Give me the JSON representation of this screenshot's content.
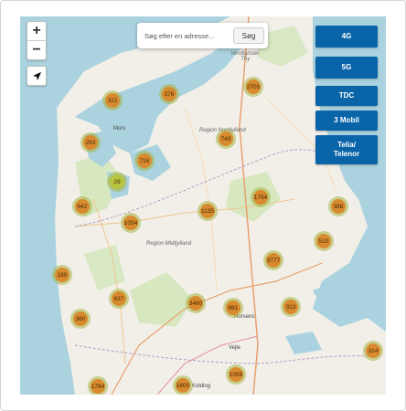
{
  "search": {
    "placeholder": "Søg efter en adresse...",
    "button": "Søg"
  },
  "zoom": {
    "in": "+",
    "out": "−"
  },
  "operators": [
    {
      "label": "4G"
    },
    {
      "label": "5G"
    },
    {
      "label": "TDC"
    },
    {
      "label": "3 Mobil"
    },
    {
      "label": "Telia/\nTelenor"
    }
  ],
  "regions": [
    {
      "name": "Vendsyssel-\nThy"
    },
    {
      "name": "Region Nordjylland"
    },
    {
      "name": "Region Midtjylland"
    }
  ],
  "towns": [
    {
      "name": "Mors"
    },
    {
      "name": "Vejle"
    },
    {
      "name": "Kolding"
    },
    {
      "name": "Horsens"
    }
  ],
  "clusters": [
    {
      "count": "322"
    },
    {
      "count": "376"
    },
    {
      "count": "2705"
    },
    {
      "count": "283"
    },
    {
      "count": "749"
    },
    {
      "count": "716"
    },
    {
      "count": "29",
      "color": "green"
    },
    {
      "count": "642"
    },
    {
      "count": "1054"
    },
    {
      "count": "1135"
    },
    {
      "count": "1794"
    },
    {
      "count": "388"
    },
    {
      "count": "510"
    },
    {
      "count": "3777"
    },
    {
      "count": "189"
    },
    {
      "count": "637"
    },
    {
      "count": "3460"
    },
    {
      "count": "981"
    },
    {
      "count": "313"
    },
    {
      "count": "360"
    },
    {
      "count": "314"
    },
    {
      "count": "1764"
    },
    {
      "count": "1600"
    },
    {
      "count": "1059"
    }
  ],
  "colors": {
    "water": "#aad3df",
    "land": "#f2efe9",
    "button": "#0a64a8",
    "cluster": "#d88a2e",
    "cluster_halo": "#a6b23f"
  }
}
